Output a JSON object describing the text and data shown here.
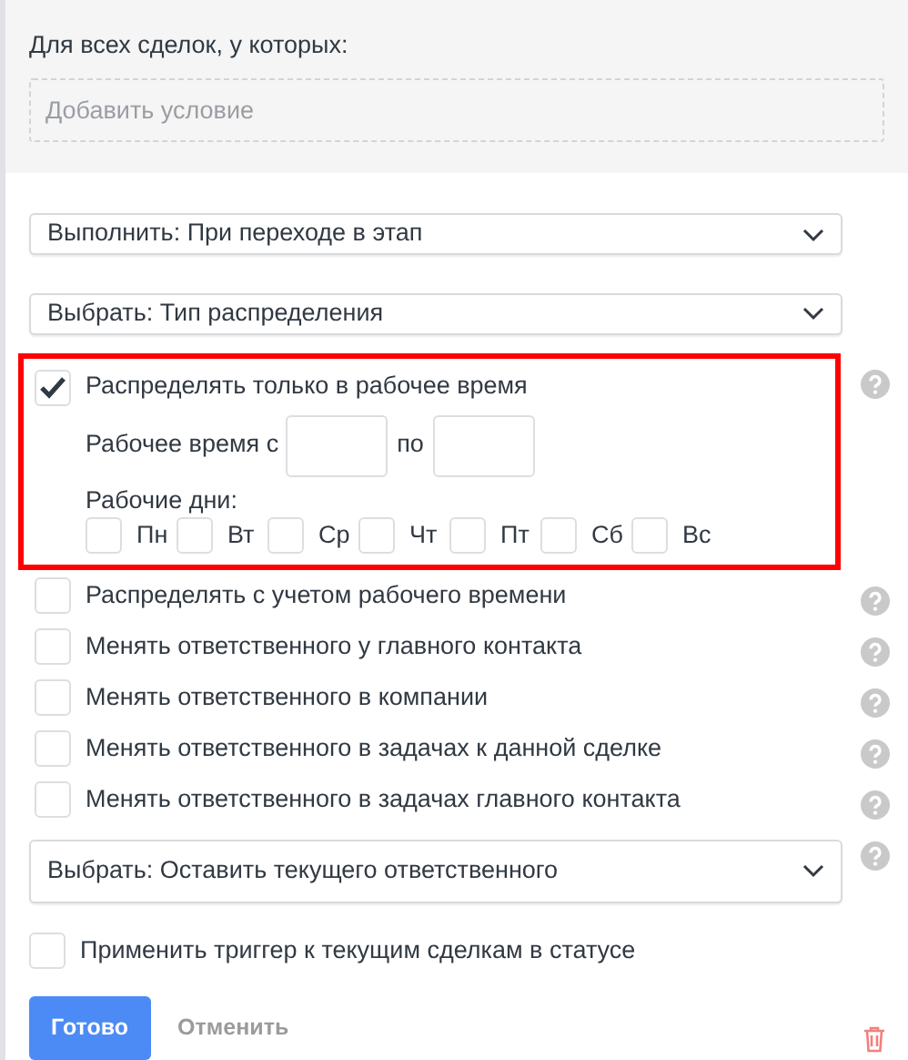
{
  "conditions": {
    "label": "Для всех сделок, у которых:",
    "placeholder": "Добавить условие"
  },
  "selects": [
    {
      "value": "Выполнить: При переходе в этап"
    },
    {
      "value": "Выбрать: Тип распределения"
    }
  ],
  "options": [
    {
      "label": "Распределять только в рабочее время",
      "checked": true,
      "highlighted": true,
      "help": true,
      "work_time": {
        "label": "Рабочее время с",
        "to_label": "по"
      },
      "days_label": "Рабочие дни:",
      "days": [
        {
          "label": "Пн",
          "checked": false
        },
        {
          "label": "Вт",
          "checked": false
        },
        {
          "label": "Ср",
          "checked": false
        },
        {
          "label": "Чт",
          "checked": false
        },
        {
          "label": "Пт",
          "checked": false
        },
        {
          "label": "Сб",
          "checked": false
        },
        {
          "label": "Вс",
          "checked": false
        }
      ]
    },
    {
      "label": "Распределять с учетом рабочего времени",
      "checked": false,
      "highlighted": false,
      "help": true
    },
    {
      "label": "Менять ответственного у главного контакта",
      "checked": false,
      "highlighted": false,
      "help": true
    },
    {
      "label": "Менять ответственного в компании",
      "checked": false,
      "highlighted": false,
      "help": true
    },
    {
      "label": "Менять ответственного в задачах к данной сделке",
      "checked": false,
      "highlighted": false,
      "help": true
    },
    {
      "label": "Менять ответственного в задачах главного контакта",
      "checked": false,
      "highlighted": false,
      "help": true
    }
  ],
  "responsible_select": {
    "value": "Выбрать: Оставить текущего ответственного",
    "help": true
  },
  "apply_option": {
    "label": "Применить триггер к текущим сделкам в статусе",
    "checked": false
  },
  "buttons": {
    "done": "Готово",
    "cancel": "Отменить"
  }
}
